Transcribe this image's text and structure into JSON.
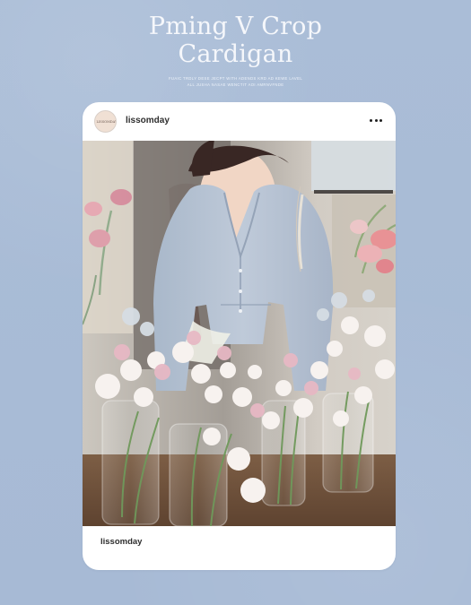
{
  "page": {
    "title_lines": [
      "Pming V Crop",
      "Cardigan"
    ],
    "subtitle_lines": [
      "Fuaic Trdly Dese Jecpt With Adends Krd Ad Kewe Lavel",
      "All Jusha Nasae Wenctit Aoi Amrnvfnde"
    ],
    "background_color": "#a9bcd6"
  },
  "post": {
    "avatar_text": "LISSOMDAY",
    "username": "lissomday",
    "footer_username": "lissomday",
    "menu_icon": "more-horizontal-icon"
  }
}
